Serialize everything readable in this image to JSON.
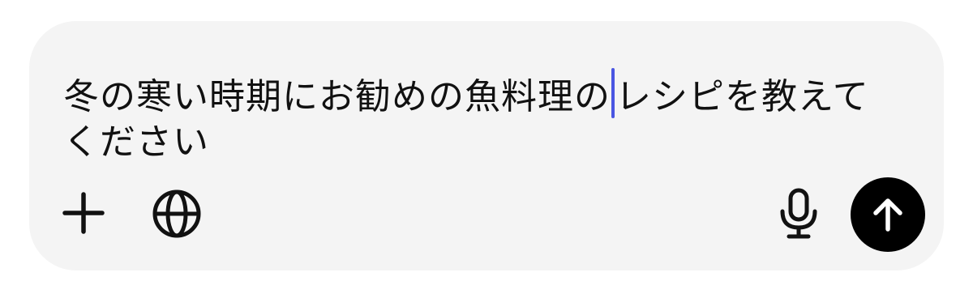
{
  "composer": {
    "text_before_caret": "冬の寒い時期にお勧めの魚料理の",
    "text_after_caret": "レシピを教えてください",
    "toolbar": {
      "left_icons": [
        "plus-icon",
        "globe-icon"
      ],
      "right_icons": [
        "microphone-icon",
        "arrow-up-icon"
      ]
    }
  },
  "colors": {
    "composer_background": "#f4f4f4",
    "caret": "#4a56e2",
    "send_button": "#000000",
    "icon": "#111111"
  }
}
